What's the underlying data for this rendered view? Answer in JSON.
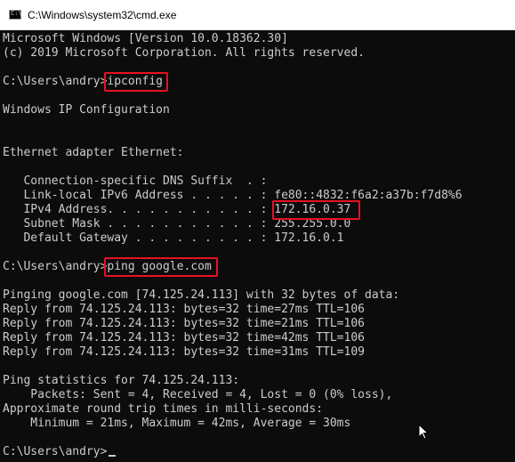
{
  "window": {
    "title": "C:\\Windows\\system32\\cmd.exe",
    "icon": "cmd-console-icon",
    "icon_glyph": "C:\\"
  },
  "console": {
    "colors": {
      "background": "#0c0c0c",
      "text": "#cccccc",
      "highlight": "#e81123"
    },
    "lines": [
      "Microsoft Windows [Version 10.0.18362.30]",
      "(c) 2019 Microsoft Corporation. All rights reserved.",
      "",
      "C:\\Users\\andry>ipconfig",
      "",
      "Windows IP Configuration",
      "",
      "",
      "Ethernet adapter Ethernet:",
      "",
      "   Connection-specific DNS Suffix  . :",
      "   Link-local IPv6 Address . . . . . : fe80::4832:f6a2:a37b:f7d8%6",
      "   IPv4 Address. . . . . . . . . . . : 172.16.0.37",
      "   Subnet Mask . . . . . . . . . . . : 255.255.0.0",
      "   Default Gateway . . . . . . . . . : 172.16.0.1",
      "",
      "C:\\Users\\andry>ping google.com",
      "",
      "Pinging google.com [74.125.24.113] with 32 bytes of data:",
      "Reply from 74.125.24.113: bytes=32 time=27ms TTL=106",
      "Reply from 74.125.24.113: bytes=32 time=21ms TTL=106",
      "Reply from 74.125.24.113: bytes=32 time=42ms TTL=106",
      "Reply from 74.125.24.113: bytes=32 time=31ms TTL=109",
      "",
      "Ping statistics for 74.125.24.113:",
      "    Packets: Sent = 4, Received = 4, Lost = 0 (0% loss),",
      "Approximate round trip times in milli-seconds:",
      "    Minimum = 21ms, Maximum = 42ms, Average = 30ms",
      "",
      "C:\\Users\\andry>"
    ]
  },
  "highlights": [
    {
      "name": "ipconfig-command-highlight",
      "text": "ipconfig"
    },
    {
      "name": "ipv4-address-highlight",
      "text": "172.16.0.37"
    },
    {
      "name": "ping-command-highlight",
      "text": "ping google.com"
    }
  ],
  "mouse_cursor": "arrow-pointer-icon"
}
